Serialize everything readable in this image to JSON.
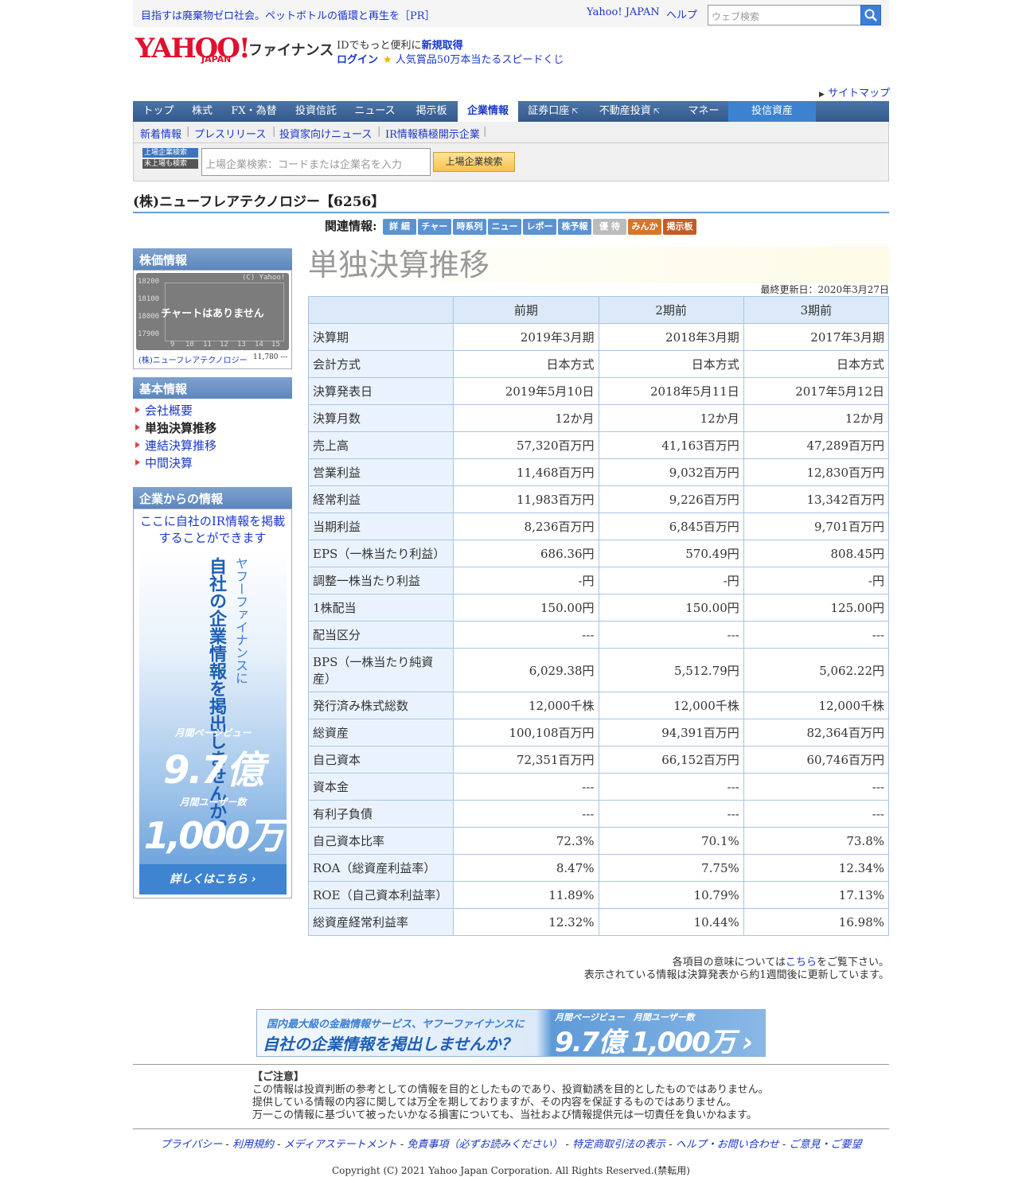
{
  "header": {
    "pr_text": "目指すは廃棄物ゼロ社会。ペットボトルの循環と再生を［PR］",
    "yahoo_japan": "Yahoo! JAPAN",
    "help": "ヘルプ",
    "search_placeholder": "ウェブ検索",
    "logo_text": "YAHOO!",
    "logo_japan": "JAPAN",
    "logo_finance": "ファイナンス",
    "id_text": "IDでもっと便利に",
    "id_link": "新規取得",
    "login": "ログイン",
    "promo": "人気賞品50万本当たるスピードくじ",
    "sitemap": "サイトマップ"
  },
  "nav": {
    "items": [
      "トップ",
      "株式",
      "FX・為替",
      "投資信託",
      "ニュース",
      "掲示板",
      "企業情報",
      "証券口座",
      "不動産投資",
      "マネー",
      "投信資産"
    ],
    "active": "企業情報"
  },
  "subnav": {
    "items": [
      "新着情報",
      "プレスリリース",
      "投資家向けニュース",
      "IR情報積極開示企業"
    ]
  },
  "company_search": {
    "tab1": "上場企業検索",
    "tab2": "未上場も検索",
    "placeholder": "上場企業検索：コードまたは企業名を入力",
    "button": "上場企業検索"
  },
  "company": {
    "name": "(株)ニューフレアテクノロジー【6256】"
  },
  "related": {
    "label": "関連情報",
    "buttons": [
      "詳 細",
      "チャート",
      "時系列",
      "ニュース",
      "レポート",
      "株予報",
      "優 待",
      "みんかぶ",
      "掲示板"
    ]
  },
  "sidebar": {
    "stock_heading": "株価情報",
    "chart_copyright": "(C) Yahoo!",
    "chart_yticks": [
      "18200",
      "18100",
      "18000",
      "17900"
    ],
    "chart_xticks": [
      "9",
      "10",
      "11",
      "12",
      "13",
      "14",
      "15"
    ],
    "no_chart": "チャートはありません",
    "chart_name": "(株)ニューフレアテクノロジー",
    "chart_value": "11,780 ---",
    "basic_heading": "基本情報",
    "basic_items": [
      "会社概要",
      "単独決算推移",
      "連結決算推移",
      "中間決算"
    ],
    "company_info_heading": "企業からの情報",
    "ir_link": "ここに自社のIR情報を掲載することができます",
    "ad_vert1": "ヤフーファイナンスに",
    "ad_vert2": "自社の企業情報を掲出しませんか？",
    "ad_pv_label": "月間ページビュー",
    "ad_pv": "9.7億",
    "ad_user_label": "月間ユーザー数",
    "ad_user": "1,000万",
    "ad_more": "詳しくはこちら ›"
  },
  "main": {
    "title": "単独決算推移",
    "updated": "最終更新日：2020年3月27日",
    "columns": [
      "",
      "前期",
      "2期前",
      "3期前"
    ],
    "rows": [
      [
        "決算期",
        "2019年3月期",
        "2018年3月期",
        "2017年3月期"
      ],
      [
        "会計方式",
        "日本方式",
        "日本方式",
        "日本方式"
      ],
      [
        "決算発表日",
        "2019年5月10日",
        "2018年5月11日",
        "2017年5月12日"
      ],
      [
        "決算月数",
        "12か月",
        "12か月",
        "12か月"
      ],
      [
        "売上高",
        "57,320百万円",
        "41,163百万円",
        "47,289百万円"
      ],
      [
        "営業利益",
        "11,468百万円",
        "9,032百万円",
        "12,830百万円"
      ],
      [
        "経常利益",
        "11,983百万円",
        "9,226百万円",
        "13,342百万円"
      ],
      [
        "当期利益",
        "8,236百万円",
        "6,845百万円",
        "9,701百万円"
      ],
      [
        "EPS（一株当たり利益）",
        "686.36円",
        "570.49円",
        "808.45円"
      ],
      [
        "調整一株当たり利益",
        "-円",
        "-円",
        "-円"
      ],
      [
        "1株配当",
        "150.00円",
        "150.00円",
        "125.00円"
      ],
      [
        "配当区分",
        "---",
        "---",
        "---"
      ],
      [
        "BPS（一株当たり純資産）",
        "6,029.38円",
        "5,512.79円",
        "5,062.22円"
      ],
      [
        "発行済み株式総数",
        "12,000千株",
        "12,000千株",
        "12,000千株"
      ],
      [
        "総資産",
        "100,108百万円",
        "94,391百万円",
        "82,364百万円"
      ],
      [
        "自己資本",
        "72,351百万円",
        "66,152百万円",
        "60,746百万円"
      ],
      [
        "資本金",
        "---",
        "---",
        "---"
      ],
      [
        "有利子負債",
        "---",
        "---",
        "---"
      ],
      [
        "自己資本比率",
        "72.3%",
        "70.1%",
        "73.8%"
      ],
      [
        "ROA（総資産利益率）",
        "8.47%",
        "7.75%",
        "12.34%"
      ],
      [
        "ROE（自己資本利益率）",
        "11.89%",
        "10.79%",
        "17.13%"
      ],
      [
        "総資産経常利益率",
        "12.32%",
        "10.44%",
        "16.98%"
      ]
    ],
    "note1_pre": "各項目の意味については",
    "note1_link": "こちら",
    "note1_post": "をご覧下さい。",
    "note2": "表示されている情報は決算発表から約1週間後に更新しています。"
  },
  "bottom_ad": {
    "line1": "国内最大級の金融情報サービス、ヤフーファイナンスに",
    "line2": "自社の企業情報を掲出しませんか？",
    "label": "月間ページビュー　月間ユーザー数",
    "numbers": "9.7億 1,000万 ›"
  },
  "caution": {
    "title": "【ご注意】",
    "lines": [
      "この情報は投資判断の参考としての情報を目的としたものであり、投資勧誘を目的としたものではありません。",
      "提供している情報の内容に関しては万全を期しておりますが、その内容を保証するものではありません。",
      "万一この情報に基づいて被ったいかなる損害についても、当社および情報提供元は一切責任を負いかねます。"
    ]
  },
  "footer": {
    "links": [
      "プライバシー",
      "利用規約",
      "メディアステートメント",
      "免責事項（必ずお読みください）",
      "特定商取引法の表示",
      "ヘルプ・お問い合わせ",
      "ご意見・ご要望"
    ],
    "copyright": "Copyright (C) 2021 Yahoo Japan Corporation. All Rights Reserved.(禁転用)"
  }
}
